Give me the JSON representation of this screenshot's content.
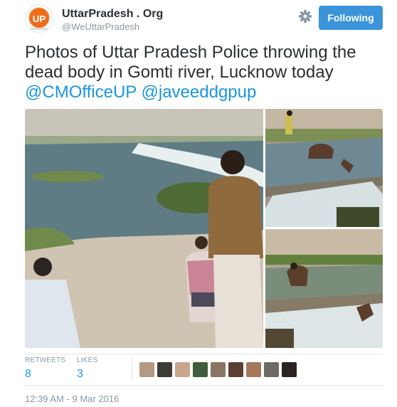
{
  "account": {
    "name": "UttarPradesh . Org",
    "handle": "@WeUttarPradesh",
    "logo_text": "UP",
    "follow_label": "Following",
    "accent": "#3b94d9"
  },
  "tweet": {
    "text": "Photos of Uttar Pradesh Police throwing the dead body in Gomti river, Lucknow today",
    "mentions": [
      "@CMOfficeUP",
      "@javeeddgpup"
    ],
    "link_color": "#1b95e0"
  },
  "stats": {
    "retweets_label": "RETWEETS",
    "retweets_value": "8",
    "likes_label": "LIKES",
    "likes_value": "3"
  },
  "liker_avatar_count": 9,
  "timestamp": "12:39 AM - 9 Mar 2016",
  "icons": [
    "gear-icon",
    "logo-icon"
  ]
}
